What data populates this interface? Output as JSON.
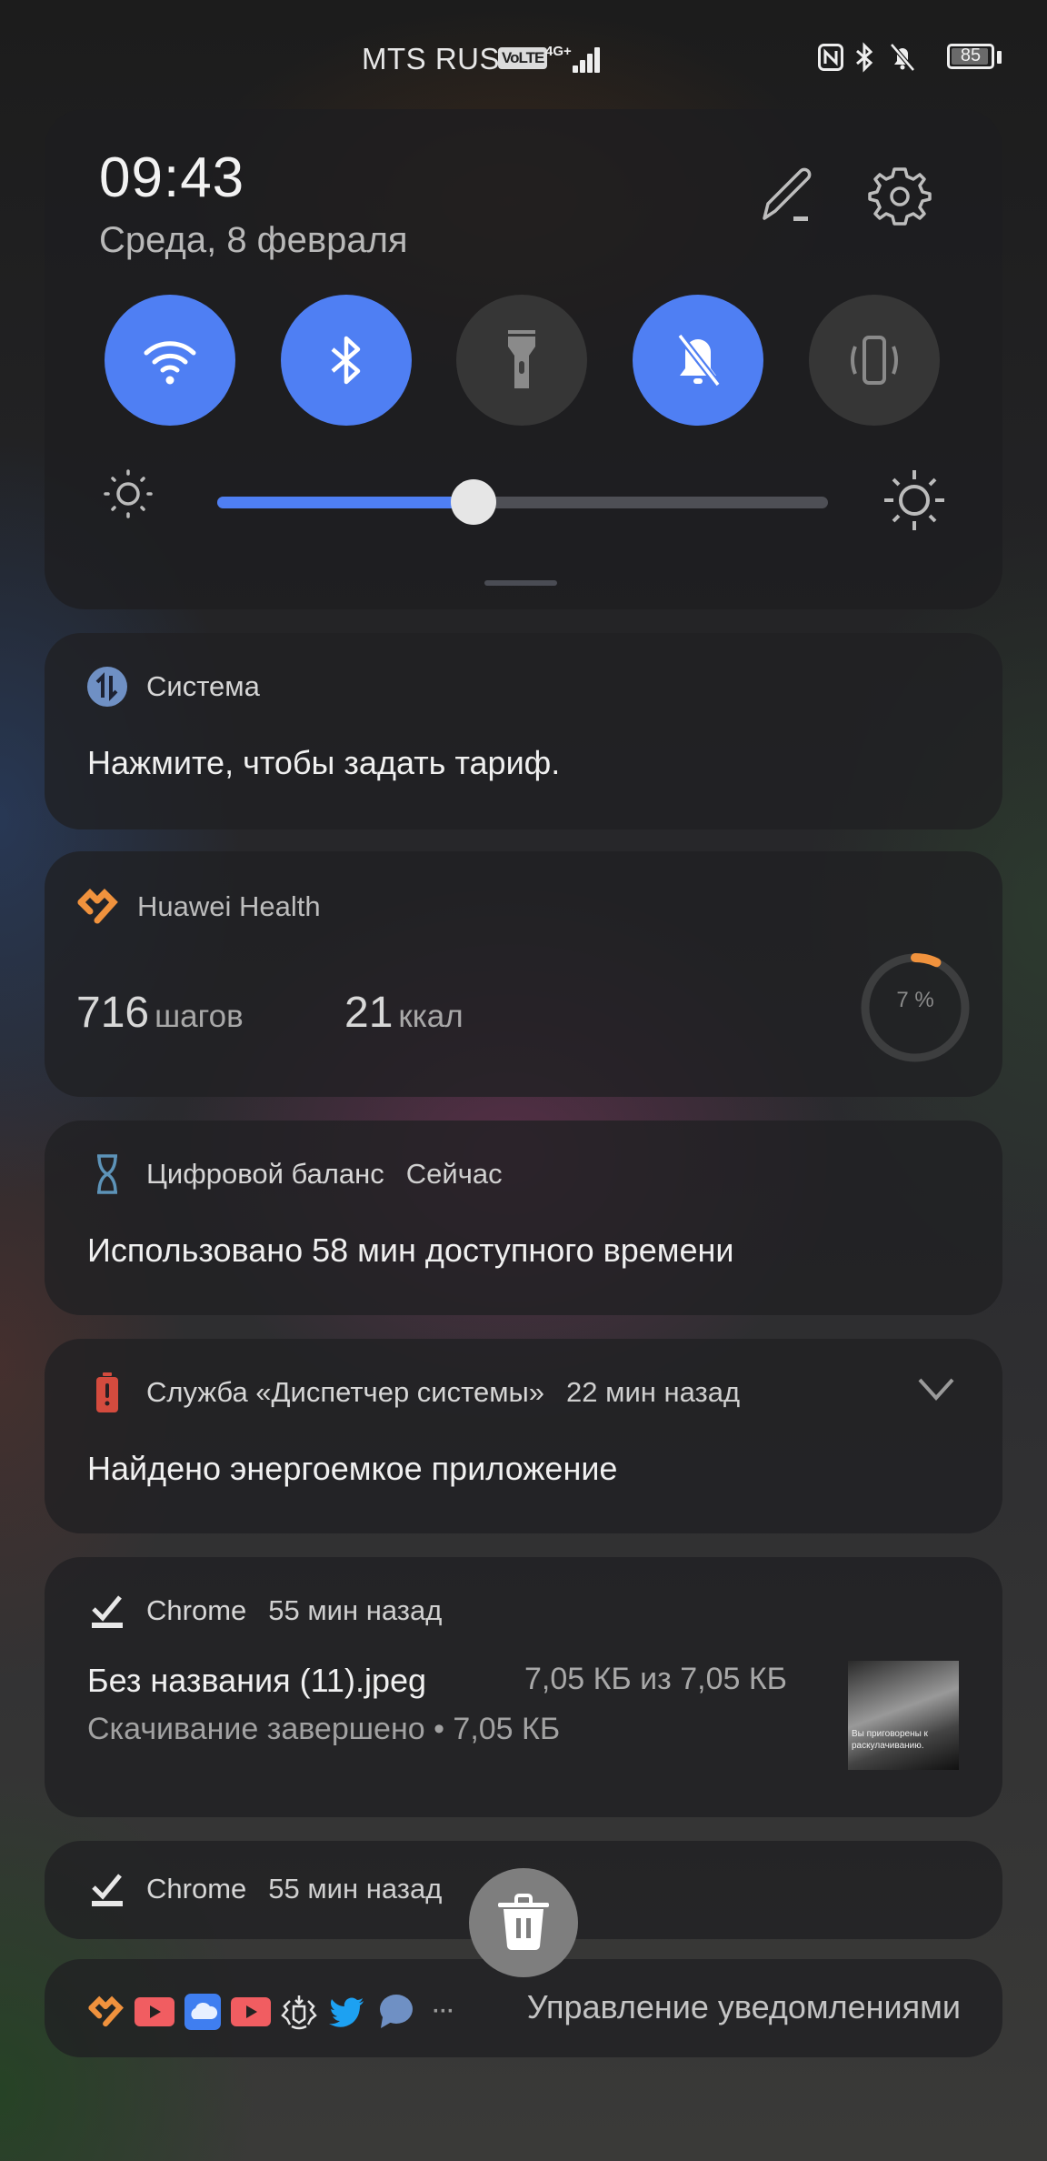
{
  "status_bar": {
    "carrier": "MTS RUS",
    "volte_badge": "VoLTE",
    "network_type": "4G+",
    "signal_bars": 4,
    "battery_percent": "85",
    "icons": [
      "nfc-icon",
      "bluetooth-icon",
      "bell-muted-icon",
      "battery-icon"
    ]
  },
  "quick_settings": {
    "time": "09:43",
    "date": "Среда, 8 февраля",
    "toggles": [
      {
        "name": "wifi",
        "icon": "wifi-icon",
        "state": "on"
      },
      {
        "name": "bluetooth",
        "icon": "bluetooth-icon",
        "state": "on"
      },
      {
        "name": "flashlight",
        "icon": "flashlight-icon",
        "state": "off"
      },
      {
        "name": "silent",
        "icon": "bell-muted-icon",
        "state": "on"
      },
      {
        "name": "vibration",
        "icon": "vibrate-icon",
        "state": "off"
      }
    ],
    "brightness_fraction": 0.42,
    "accent_color": "#4f7ff3"
  },
  "notifications": {
    "system": {
      "app": "Система",
      "body": "Нажмите, чтобы задать тариф."
    },
    "health": {
      "app": "Huawei Health",
      "steps_value": "716",
      "steps_unit": "шагов",
      "kcal_value": "21",
      "kcal_unit": "ккал",
      "goal_percent_label": "7 %",
      "goal_fraction": 0.07,
      "accent_color": "#f0923d"
    },
    "digital_balance": {
      "app": "Цифровой баланс",
      "time": "Сейчас",
      "body": "Использовано 58 мин доступного времени"
    },
    "system_manager": {
      "app": "Служба «Диспетчер системы»",
      "time": "22 мин назад",
      "body": "Найдено энергоемкое приложение"
    },
    "chrome_download": {
      "app": "Chrome",
      "time": "55 мин назад",
      "file_name": "Без названия (11).jpeg",
      "size_progress": "7,05 КБ из 7,05 КБ",
      "status": "Скачивание завершено • 7,05 КБ",
      "thumbnail_caption": "Вы приговорены к раскулачиванию."
    },
    "chrome_collapsed": {
      "app": "Chrome",
      "time": "55 мин назад"
    }
  },
  "footer": {
    "app_icons": [
      "huawei-health-icon",
      "youtube-icon",
      "cloud-icon",
      "youtube-icon",
      "emblem-icon",
      "twitter-icon",
      "chat-bubble-icon",
      "more-icon"
    ],
    "more_label": "···",
    "manage_label": "Управление уведомлениями"
  }
}
